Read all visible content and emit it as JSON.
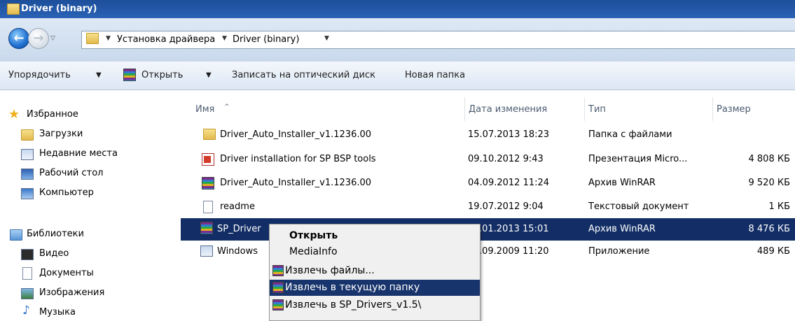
{
  "window": {
    "title": "Driver (binary)"
  },
  "address": {
    "crumbs": [
      "Установка драйвера",
      "Driver (binary)"
    ]
  },
  "commands": {
    "organize": "Упорядочить",
    "open": "Открыть",
    "burn": "Записать на оптический диск",
    "new_folder": "Новая папка"
  },
  "sidebar": {
    "favorites_header": "Избранное",
    "favorites": [
      "Загрузки",
      "Недавние места",
      "Рабочий стол",
      "Компьютер"
    ],
    "libraries_header": "Библиотеки",
    "libraries": [
      "Видео",
      "Документы",
      "Изображения",
      "Музыка"
    ]
  },
  "columns": [
    "Имя",
    "Дата изменения",
    "Тип",
    "Размер"
  ],
  "files": [
    {
      "name": "Driver_Auto_Installer_v1.1236.00",
      "date": "15.07.2013 18:23",
      "type": "Папка с файлами",
      "size": "",
      "icon": "folder-icon"
    },
    {
      "name": "Driver installation for SP BSP tools",
      "date": "09.10.2012 9:43",
      "type": "Презентация Micro...",
      "size": "4 808 КБ",
      "icon": "powerpoint-icon"
    },
    {
      "name": "Driver_Auto_Installer_v1.1236.00",
      "date": "04.09.2012 11:24",
      "type": "Архив WinRAR",
      "size": "9 520 КБ",
      "icon": "winrar-icon"
    },
    {
      "name": "readme",
      "date": "19.07.2012 9:04",
      "type": "Текстовый документ",
      "size": "1 КБ",
      "icon": "text-file-icon"
    },
    {
      "name": "SP_Driver",
      "date": ".01.2013 15:01",
      "type": "Архив WinRAR",
      "size": "8 476 КБ",
      "icon": "winrar-icon"
    },
    {
      "name": "Windows",
      "date": ".09.2009 11:20",
      "type": "Приложение",
      "size": "489 КБ",
      "icon": "application-icon"
    }
  ],
  "context_menu": {
    "items": [
      "Открыть",
      "MediaInfo",
      "Извлечь файлы...",
      "Извлечь в текущую папку",
      "Извлечь в SP_Drivers_v1.5\\"
    ]
  }
}
